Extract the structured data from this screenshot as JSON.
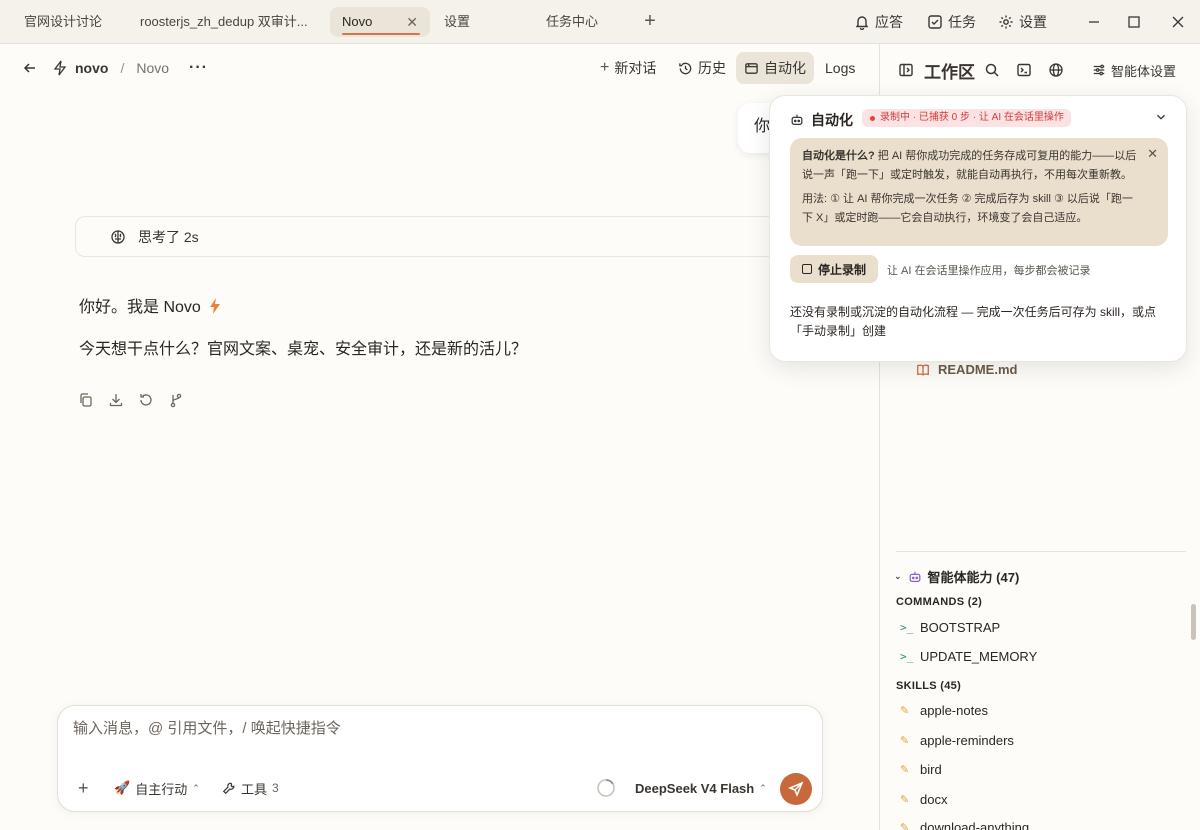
{
  "tabs": [
    {
      "label": "官网设计讨论"
    },
    {
      "label": "roosterjs_zh_dedup 双审计..."
    },
    {
      "label": "Novo",
      "active": true
    },
    {
      "label": "设置"
    },
    {
      "label": "任务中心"
    }
  ],
  "topbar": {
    "reply_label": "应答",
    "tasks_label": "任务",
    "settings_label": "设置"
  },
  "chat_header": {
    "project": "novo",
    "separator": "/",
    "session": "Novo",
    "new_chat": "新对话",
    "history": "历史",
    "automation": "自动化",
    "logs": "Logs"
  },
  "conversation": {
    "user_bubble_text": "你",
    "thinking_label": "思考了 2s",
    "greeting": "你好。我是 Novo",
    "question": "今天想干点什么？官网文案、桌宠、安全审计，还是新的活儿？"
  },
  "composer": {
    "placeholder": "输入消息，@ 引用文件，/ 唤起快捷指令",
    "mode_label": "自主行动",
    "tools_label": "工具",
    "tools_count": "3",
    "model_label": "DeepSeek V4 Flash"
  },
  "automation": {
    "title": "自动化",
    "badge": "录制中 · 已捕获 0 步 · 让 AI 在会话里操作",
    "info_question": "自动化是什么?",
    "info_text": " 把 AI 帮你成功完成的任务存成可复用的能力——以后说一声「跑一下」或定时触发，就能自动再执行，不用每次重新教。",
    "info_usage": "用法: ① 让 AI 帮你完成一次任务 ② 完成后存为 skill ③ 以后说「跑一下 X」或定时跑——它会自动执行，环境变了会自己适应。",
    "stop_label": "停止录制",
    "stop_hint": "让 AI 在会话里操作应用，每步都会被记录",
    "empty_text": "还没有录制或沉淀的自动化流程 — 完成一次任务后可存为 skill，或点「手动录制」创建"
  },
  "workspace": {
    "title": "工作区",
    "agent_settings": "智能体设置",
    "readme": "README.md",
    "capabilities_label": "智能体能力 (47)",
    "commands_label": "COMMANDS (2)",
    "commands": [
      "BOOTSTRAP",
      "UPDATE_MEMORY"
    ],
    "skills_label": "SKILLS (45)",
    "skills": [
      "apple-notes",
      "apple-reminders",
      "bird",
      "docx",
      "download-anything"
    ]
  },
  "colors": {
    "accent": "#c8693c",
    "tab_underline": "#d4764a",
    "recording_red": "#d43c3c",
    "info_bg": "#eadfcd"
  }
}
